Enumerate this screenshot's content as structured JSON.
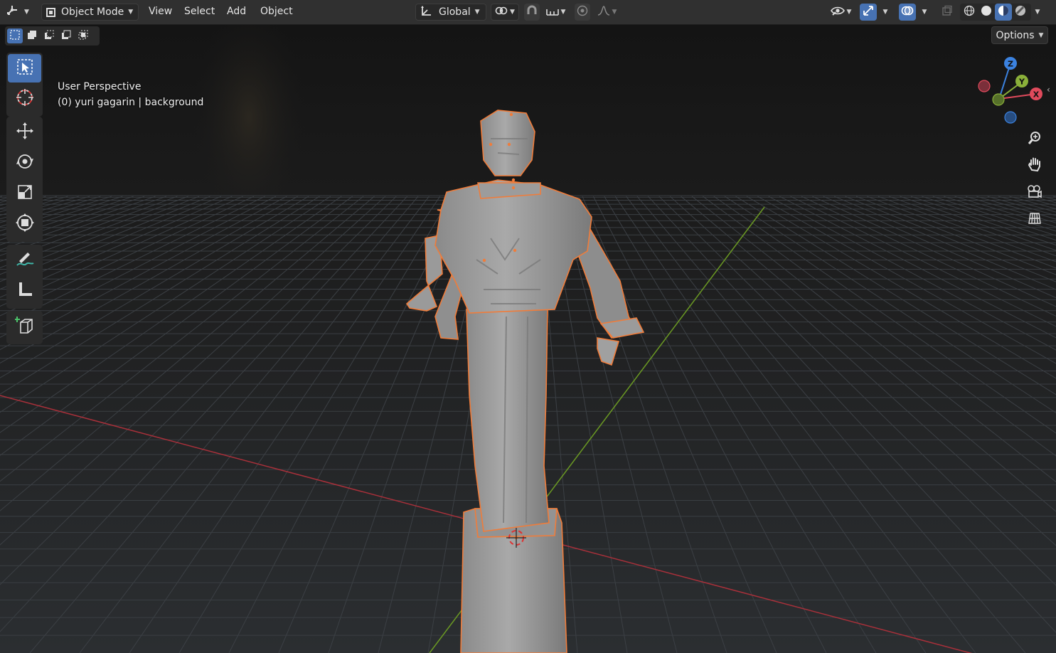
{
  "header": {
    "editor_type_icon": "3d-viewport-icon",
    "mode": {
      "icon": "object-mode-icon",
      "label": "Object Mode"
    },
    "menus": [
      "View",
      "Select",
      "Add",
      "Object"
    ],
    "transform_orientation": {
      "icon": "orientation-global-icon",
      "label": "Global"
    },
    "pivot_icon": "pivot-point-icon",
    "snap_icon": "snap-magnet-icon",
    "snap_target_icon": "snap-increment-icon",
    "proportional_icon": "proportional-edit-icon",
    "falloff_icon": "falloff-curve-icon",
    "visibility_icon": "eye-visibility-icon",
    "gizmo_icon": "gizmo-toggle-icon",
    "overlay_icon": "overlays-icon",
    "xray_icon": "xray-toggle-icon",
    "shading_modes": [
      "wireframe-shading-icon",
      "solid-shading-icon",
      "material-preview-icon",
      "rendered-shading-icon"
    ],
    "active_shading": "material-preview-icon"
  },
  "selection_modes": [
    "select-new-icon",
    "select-extend-icon",
    "select-subtract-icon",
    "select-invert-icon",
    "select-intersect-icon"
  ],
  "options_label": "Options",
  "toolbar": {
    "tools": [
      {
        "name": "select-box-tool",
        "icon": "select-box-icon",
        "active": true
      },
      {
        "name": "cursor-tool",
        "icon": "cursor-icon",
        "active": false
      },
      {
        "name": "move-tool",
        "icon": "move-icon",
        "active": false
      },
      {
        "name": "rotate-tool",
        "icon": "rotate-icon",
        "active": false
      },
      {
        "name": "scale-tool",
        "icon": "scale-icon",
        "active": false
      },
      {
        "name": "transform-tool",
        "icon": "transform-icon",
        "active": false
      },
      {
        "name": "annotate-tool",
        "icon": "annotate-icon",
        "active": false
      },
      {
        "name": "measure-tool",
        "icon": "measure-icon",
        "active": false
      },
      {
        "name": "add-cube-tool",
        "icon": "add-cube-icon",
        "active": false
      }
    ]
  },
  "viewport": {
    "view_name": "User Perspective",
    "object_info": "(0) yuri gagarin | background",
    "object_model": "statue-model",
    "axis_gizmo": {
      "labels": [
        "Z",
        "Y",
        "X"
      ],
      "colors": {
        "x": "#e04a5c",
        "y": "#8bb03a",
        "z": "#3b82e0"
      }
    },
    "nav_buttons": [
      "zoom-icon",
      "pan-hand-icon",
      "camera-view-icon",
      "ortho-grid-icon"
    ],
    "colors": {
      "selection_outline": "#f07c3a",
      "x_axis_line": "#a8303a",
      "y_axis_line": "#6b9a23",
      "accent": "#4772b3"
    }
  }
}
